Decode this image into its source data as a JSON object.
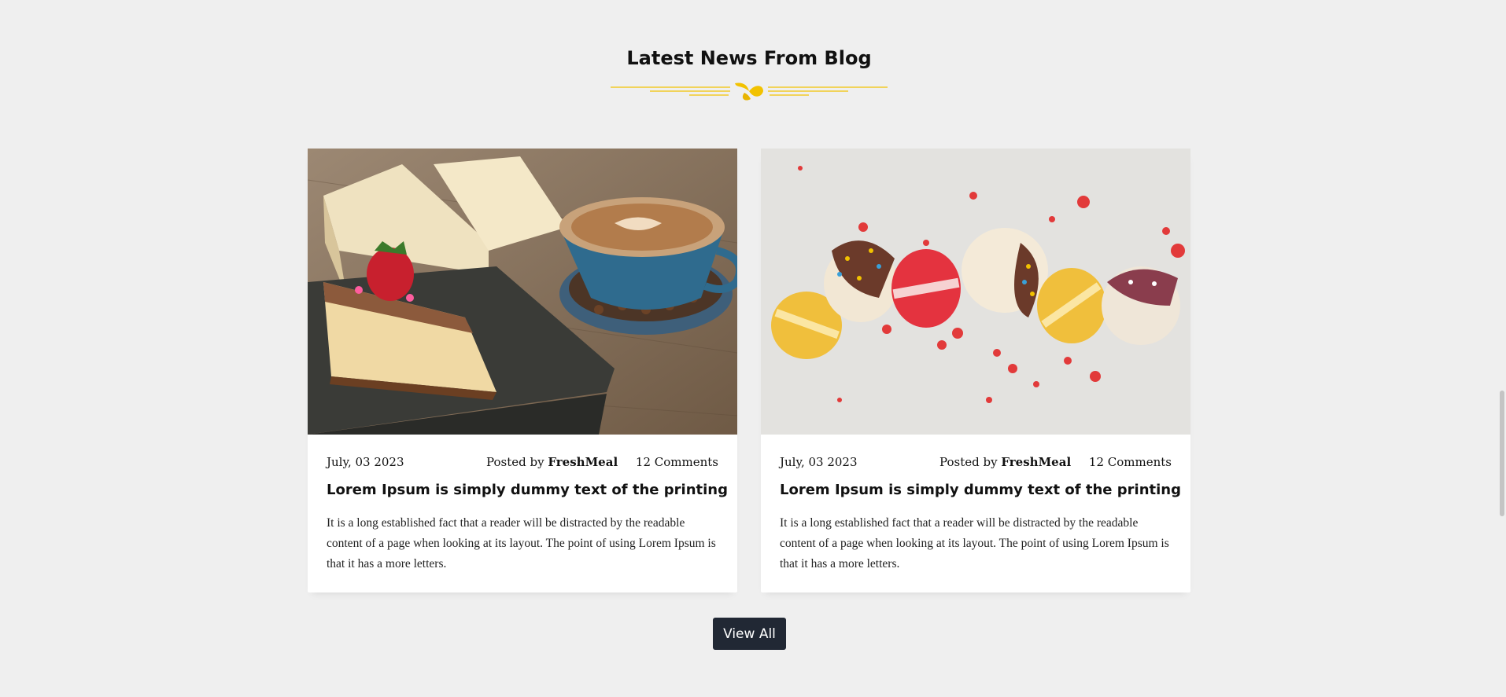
{
  "section": {
    "title": "Latest News From Blog"
  },
  "colors": {
    "accent": "#f2c200",
    "page_bg": "#efefef",
    "button_bg": "#212834"
  },
  "posts": [
    {
      "image": "cake-coffee-book-photo",
      "date": "July, 03 2023",
      "posted_by_label": "Posted by",
      "author": "FreshMeal",
      "comments": "12 Comments",
      "title": "Lorem Ipsum is simply dummy text of the printing",
      "excerpt": "It is a long established fact that a reader will be distracted by the readable content of a page when looking at its layout. The point of using Lorem Ipsum is that it has a more letters."
    },
    {
      "image": "macarons-photo",
      "date": "July, 03 2023",
      "posted_by_label": "Posted by",
      "author": "FreshMeal",
      "comments": "12 Comments",
      "title": "Lorem Ipsum is simply dummy text of the printing",
      "excerpt": "It is a long established fact that a reader will be distracted by the readable content of a page when looking at its layout. The point of using Lorem Ipsum is that it has a more letters."
    }
  ],
  "actions": {
    "view_all_label": "View All"
  }
}
